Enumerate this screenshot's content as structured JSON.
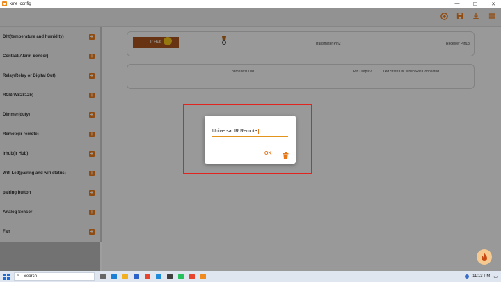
{
  "window": {
    "title": "kme_config",
    "controls": [
      "—",
      "☐",
      "✕"
    ]
  },
  "toolbar": {
    "icons": [
      "add-circle-icon",
      "save-icon",
      "download-icon",
      "menu-icon"
    ],
    "accent": "#e8791b"
  },
  "sidebar": {
    "items": [
      {
        "label": "Dht(temperature and humidity)"
      },
      {
        "label": "Contact(Alarm Sensor)"
      },
      {
        "label": "Relay(Relay or Digital Out)"
      },
      {
        "label": "RGB(WS2812b)"
      },
      {
        "label": "Dimmer(duty)"
      },
      {
        "label": "Remote(ir remote)"
      },
      {
        "label": "irhub(ir Hub)"
      },
      {
        "label": "Wifi Led(pairing and wifi status)"
      },
      {
        "label": "pairing button"
      },
      {
        "label": "Analog Sensor"
      },
      {
        "label": "Fan"
      }
    ],
    "plus_symbol": "+"
  },
  "cards": {
    "card1": {
      "button_label": "Ir Hub",
      "transmitter": "Transmitter Pin2",
      "receiver": "Receiver Pin13"
    },
    "card2": {
      "name": "name:Wifi Led",
      "pin_output": "Pin Output2",
      "led_state": "Led State:ON When Wifi Connected"
    }
  },
  "dialog": {
    "input_value": "Universal IR Remote",
    "ok_label": "OK"
  },
  "taskbar": {
    "search_placeholder": "Search",
    "time": "11:13 PM"
  }
}
